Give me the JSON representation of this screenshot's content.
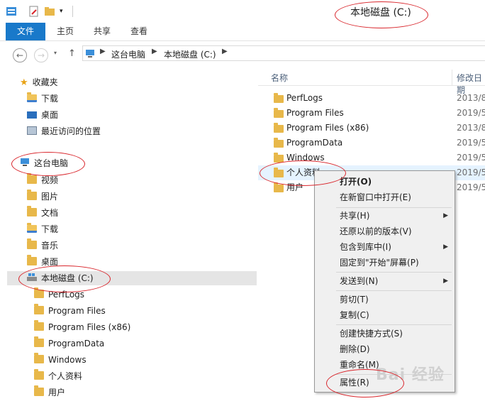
{
  "window": {
    "title": "本地磁盘 (C:)"
  },
  "ribbon": {
    "tabs": [
      "文件",
      "主页",
      "共享",
      "查看"
    ]
  },
  "address": {
    "crumbs": [
      "这台电脑",
      "本地磁盘 (C:)"
    ]
  },
  "nav_pane": {
    "favorites_label": "收藏夹",
    "favorites": [
      "下载",
      "桌面",
      "最近访问的位置"
    ],
    "this_pc_label": "这台电脑",
    "libraries": [
      "视频",
      "图片",
      "文档",
      "下载",
      "音乐",
      "桌面"
    ],
    "drive_label": "本地磁盘 (C:)",
    "drive_folders": [
      "PerfLogs",
      "Program Files",
      "Program Files (x86)",
      "ProgramData",
      "Windows",
      "个人资料",
      "用户"
    ]
  },
  "file_list": {
    "col_name": "名称",
    "col_date": "修改日期",
    "rows": [
      {
        "name": "PerfLogs",
        "date": "2013/8"
      },
      {
        "name": "Program Files",
        "date": "2019/5"
      },
      {
        "name": "Program Files (x86)",
        "date": "2013/8"
      },
      {
        "name": "ProgramData",
        "date": "2019/5"
      },
      {
        "name": "Windows",
        "date": "2019/5"
      },
      {
        "name": "个人资料",
        "date": "2019/5"
      },
      {
        "name": "用户",
        "date": "2019/5"
      }
    ]
  },
  "context_menu": {
    "open": "打开(O)",
    "open_new_window": "在新窗口中打开(E)",
    "share": "共享(H)",
    "restore": "还原以前的版本(V)",
    "include_library": "包含到库中(I)",
    "pin_start": "固定到\"开始\"屏幕(P)",
    "send_to": "发送到(N)",
    "cut": "剪切(T)",
    "copy": "复制(C)",
    "create_shortcut": "创建快捷方式(S)",
    "delete": "删除(D)",
    "rename": "重命名(M)",
    "properties": "属性(R)"
  },
  "watermark": "Bai 经验",
  "colors": {
    "accent": "#1979ca",
    "annotation": "#d9262c",
    "folder": "#e8b84a"
  }
}
